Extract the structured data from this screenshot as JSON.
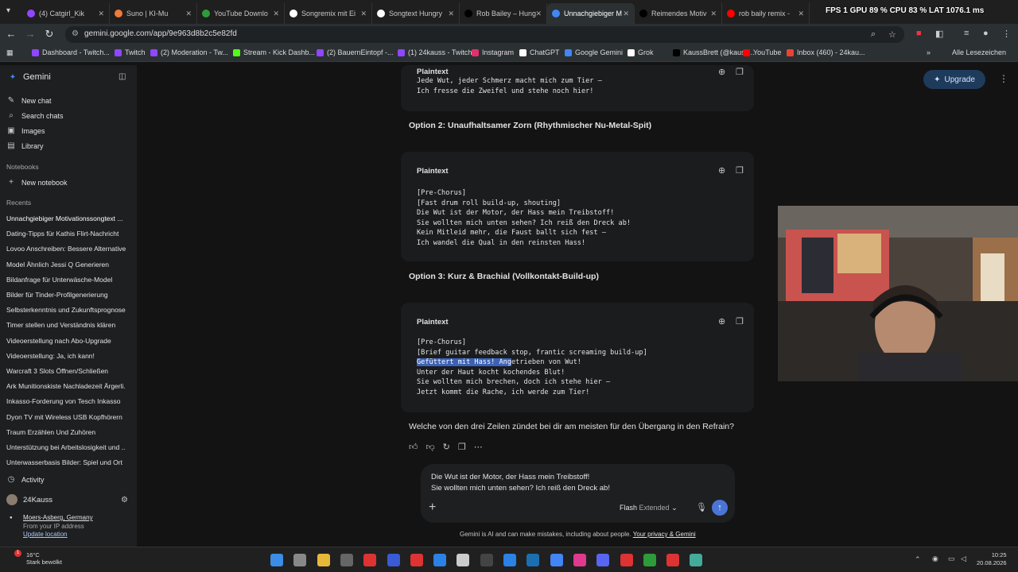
{
  "browser": {
    "tabs": [
      {
        "label": "(4) Catgirl_Kik",
        "color": "#9146ff"
      },
      {
        "label": "Suno | KI-Mu",
        "color": "#f07a3a"
      },
      {
        "label": "YouTube Downlo",
        "color": "#2e9b3a"
      },
      {
        "label": "Songremix mit Ei",
        "color": "#ffffff"
      },
      {
        "label": "Songtext Hungry",
        "color": "#ffffff"
      },
      {
        "label": "Rob Bailey – Hung",
        "color": "#000000"
      },
      {
        "label": "Unnachgiebiger M",
        "color": "#4285f4",
        "active": true
      },
      {
        "label": "Reimendes Motiv",
        "color": "#000000"
      },
      {
        "label": "rob baily remix -",
        "color": "#ff0000"
      }
    ],
    "perf_overlay": "FPS 1  GPU 89 %  CPU 83 %  LAT 1076.1 ms",
    "url": "gemini.google.com/app/9e963d8b2c5e82fd",
    "bookmarks": [
      {
        "label": "Dashboard - Twitch...",
        "color": "#9146ff"
      },
      {
        "label": "Twitch",
        "color": "#9146ff"
      },
      {
        "label": "(2) Moderation - Tw...",
        "color": "#9146ff"
      },
      {
        "label": "Stream - Kick Dashb...",
        "color": "#53fc18"
      },
      {
        "label": "(2) BauernEintopf -...",
        "color": "#9146ff"
      },
      {
        "label": "(1) 24kauss - Twitch",
        "color": "#9146ff"
      },
      {
        "label": "Instagram",
        "color": "#e1306c"
      },
      {
        "label": "ChatGPT",
        "color": "#ffffff"
      },
      {
        "label": "Google Gemini",
        "color": "#4285f4"
      },
      {
        "label": "Grok",
        "color": "#ffffff"
      },
      {
        "label": "KaussBrett (@kauss...",
        "color": "#000000"
      },
      {
        "label": "YouTube",
        "color": "#ff0000"
      },
      {
        "label": "Inbox (460) - 24kau...",
        "color": "#ea4335"
      }
    ],
    "all_bookmarks": "Alle Lesezeichen"
  },
  "sidebar": {
    "app_name": "Gemini",
    "items": [
      {
        "label": "New chat",
        "icon": "edit-icon"
      },
      {
        "label": "Search chats",
        "icon": "search-icon"
      },
      {
        "label": "Images",
        "icon": "image-icon"
      },
      {
        "label": "Library",
        "icon": "library-icon"
      }
    ],
    "notebooks_heading": "Notebooks",
    "new_notebook": "New notebook",
    "recents_heading": "Recents",
    "recents": [
      "Unnachgiebiger Motivationssongtext ...",
      "Dating-Tipps für Kathis Flirt-Nachricht",
      "Lovoo Anschreiben: Bessere Alternativen",
      "Model Ähnlich Jessi Q Generieren",
      "Bildanfrage für Unterwäsche-Model",
      "Bilder für Tinder-Profilgenerierung",
      "Selbsterkenntnis und Zukunftsprognose",
      "Timer stellen und Verständnis klären",
      "Videoerstellung nach Abo-Upgrade",
      "Videoerstellung: Ja, ich kann!",
      "Warcraft 3 Slots Öffnen/Schließen",
      "Ark Munitionskiste Nachladezeit Ärgerli...",
      "Inkasso-Forderung von Tesch Inkasso",
      "Dyon TV mit Wireless USB Kopfhörern",
      "Traum Erzählen Und Zuhören",
      "Unterstützung bei Arbeitslosigkeit und ...",
      "Unterwasserbasis Bilder: Spiel und Ort"
    ],
    "activity": "Activity",
    "user": "24Kauss",
    "location": "Moers-Asberg, Germany",
    "location_sub": "From your IP address",
    "update_location": "Update location"
  },
  "main": {
    "upgrade": "Upgrade",
    "card0_title": "Plaintext",
    "card0_lines": "Jede Wut, jeder Schmerz macht mich zum Tier –\nIch fresse die Zweifel und stehe noch hier!",
    "option2": "Option 2: Unaufhaltsamer Zorn (Rhythmischer Nu-Metal-Spit)",
    "card1_title": "Plaintext",
    "card1_lines": "[Pre-Chorus]\n[Fast drum roll build-up, shouting]\nDie Wut ist der Motor, der Hass mein Treibstoff!\nSie wollten mich unten sehen? Ich reiß den Dreck ab!\nKein Mitleid mehr, die Faust ballt sich fest –\nIch wandel die Qual in den reinsten Hass!",
    "option3": "Option 3: Kurz & Brachial (Vollkontakt-Build-up)",
    "card2_title": "Plaintext",
    "card2_lines_a": "[Pre-Chorus]\n[Brief guitar feedback stop, frantic screaming build-up]",
    "card2_highlight": "Gefüttert mit Hass! Ang",
    "card2_rest": "etrieben von Wut!",
    "card2_lines_b": "Unter der Haut kocht kochendes Blut!\nSie wollten mich brechen, doch ich stehe hier –\nJetzt kommt die Rache, ich werde zum Tier!",
    "question": "Welche von den drei Zeilen zündet bei dir am meisten für den Übergang in den Refrain?",
    "input_text": "Die Wut ist der Motor, der Hass mein Treibstoff!\nSie wollten mich unten sehen? Ich reiß den Dreck ab!",
    "model": "Flash",
    "model_sub": "Extended",
    "disclaimer": "Gemini is AI and can make mistakes, including about people.",
    "disclaimer_link": "Your privacy & Gemini"
  },
  "taskbar": {
    "temp": "16°C",
    "weather": "Stark bewölkt",
    "time": "10:25",
    "date": "20.08.2026"
  }
}
